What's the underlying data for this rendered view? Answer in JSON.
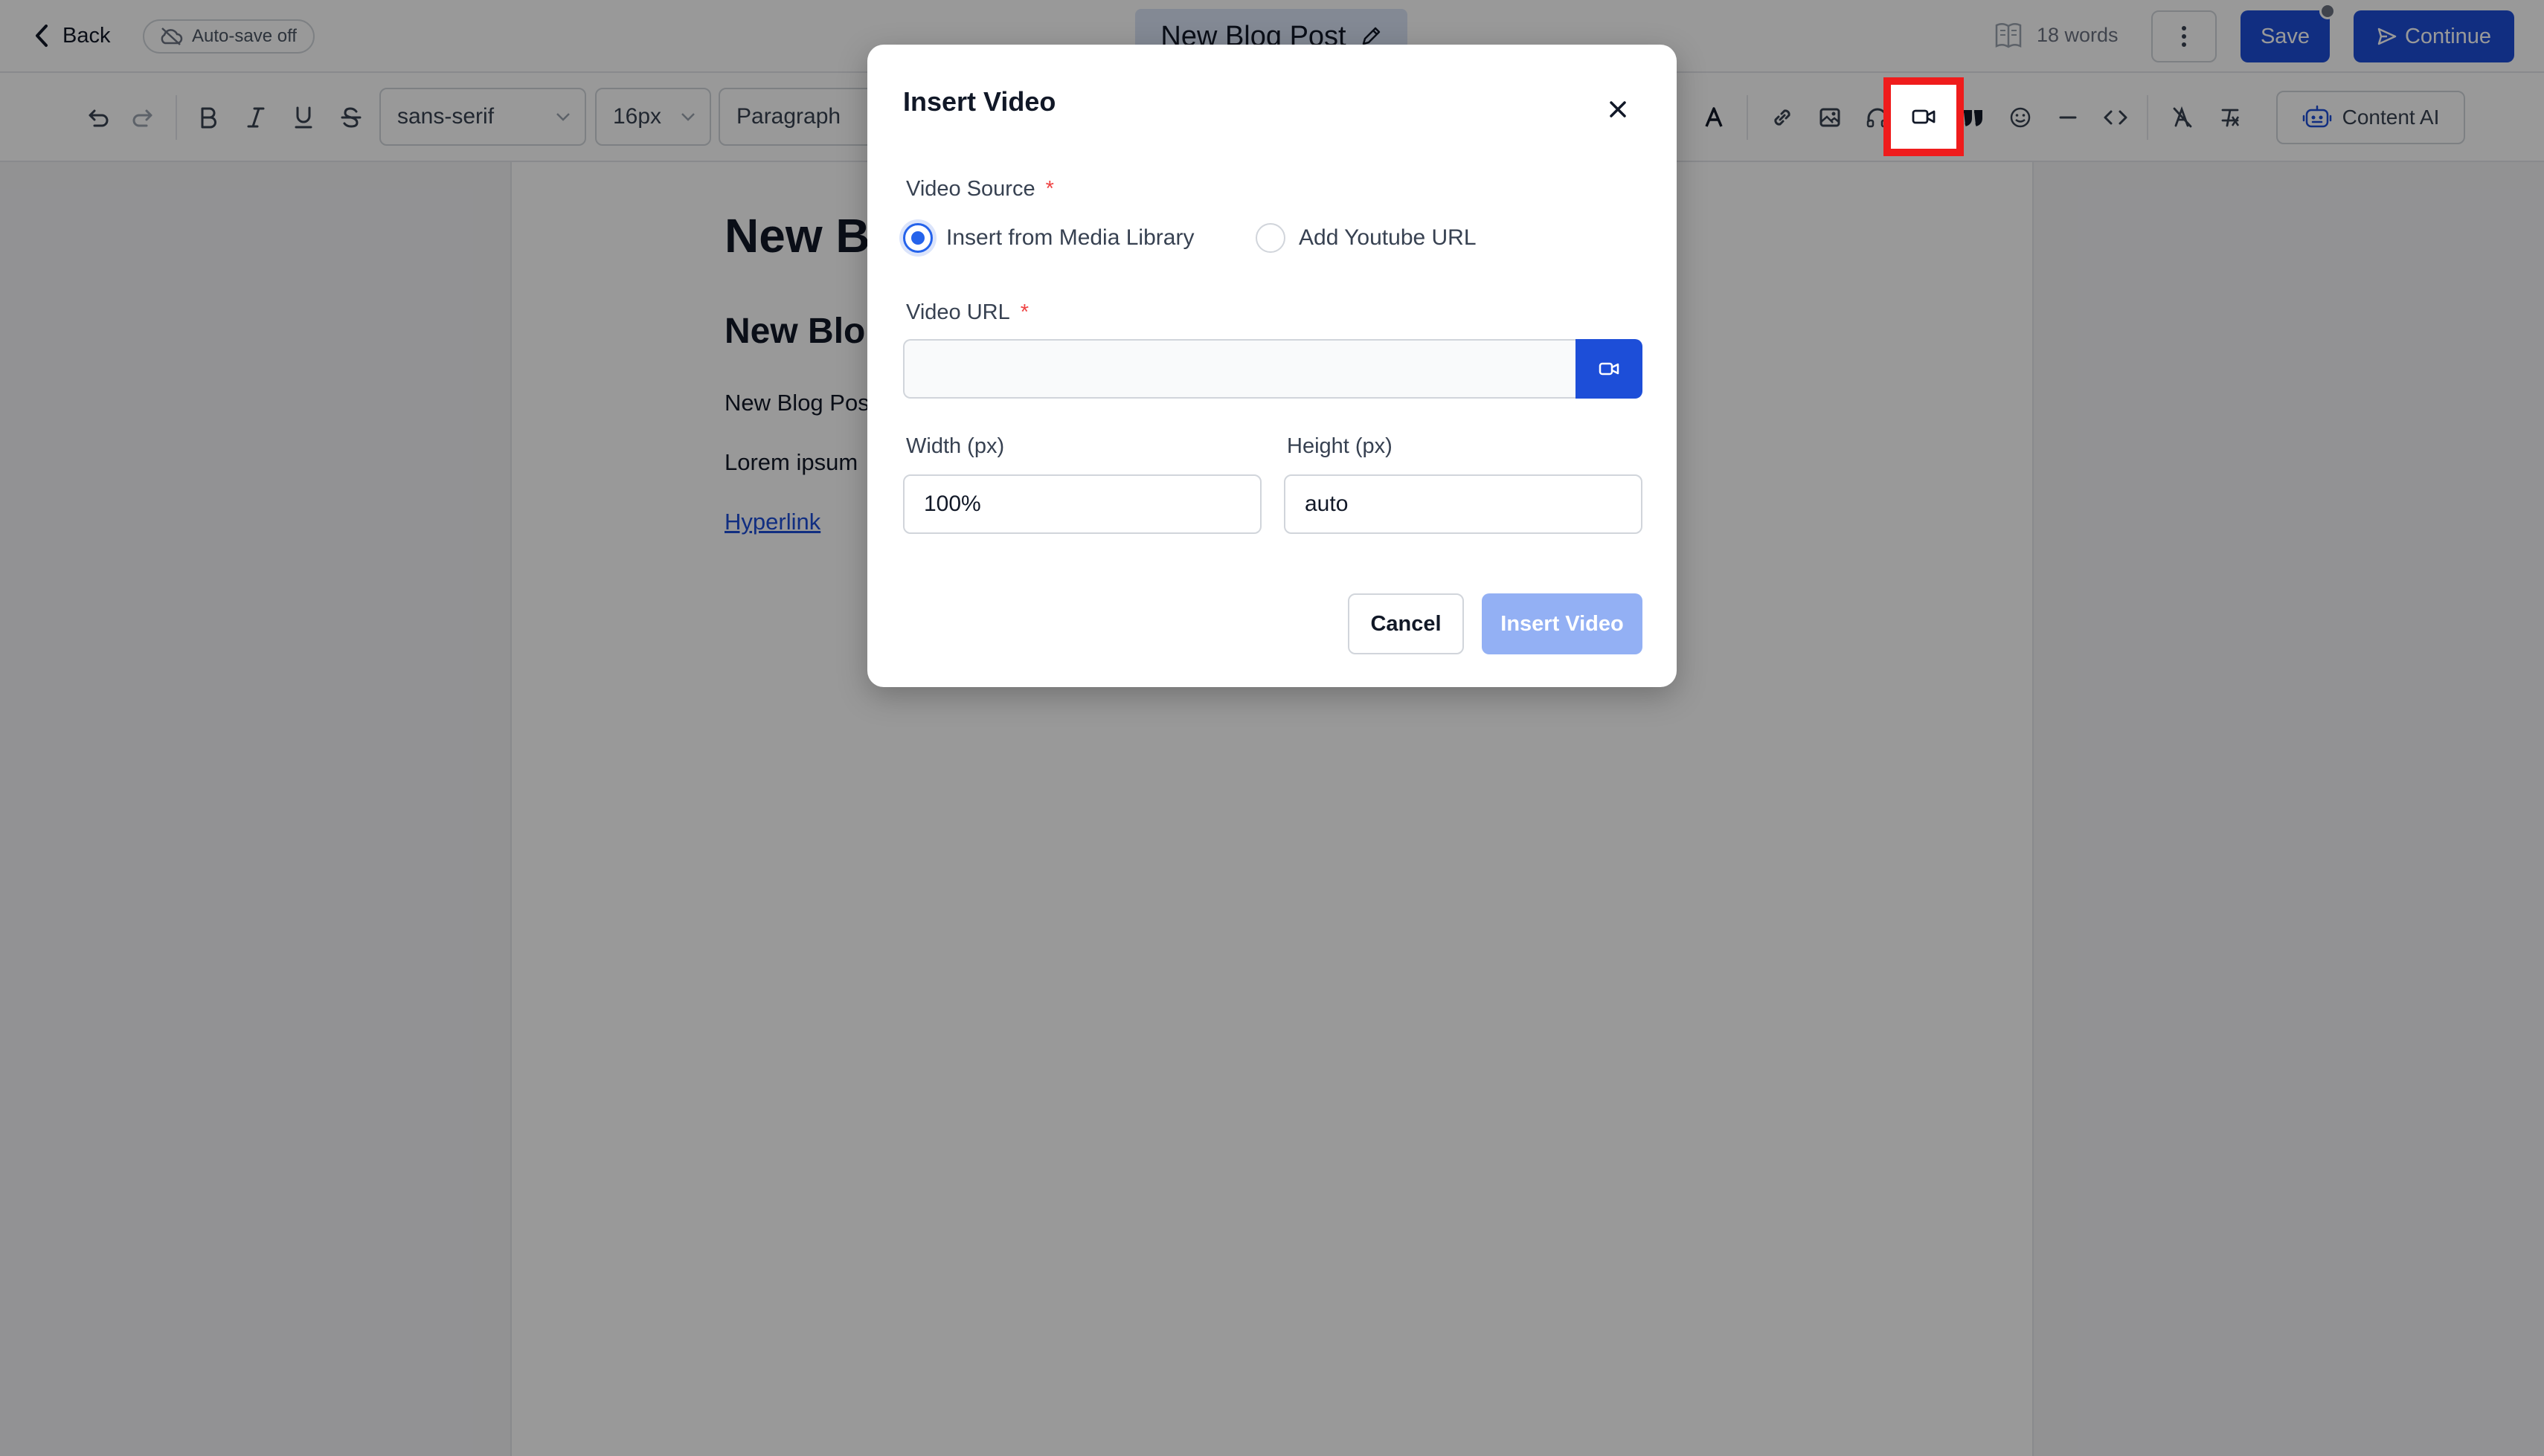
{
  "topbar": {
    "back_label": "Back",
    "autosave_label": "Auto-save off",
    "title": "New Blog Post",
    "word_count": "18 words",
    "save_label": "Save",
    "continue_label": "Continue"
  },
  "toolbar": {
    "font_family": "sans-serif",
    "font_size": "16px",
    "block_type": "Paragraph",
    "content_ai_label": "Content AI",
    "icons": [
      "undo-icon",
      "redo-icon",
      "bold-icon",
      "italic-icon",
      "underline-icon",
      "strikethrough-icon",
      "text-color-icon",
      "link-icon",
      "image-icon",
      "audio-icon",
      "video-icon",
      "quote-icon",
      "emoji-icon",
      "horizontal-rule-icon",
      "code-icon",
      "clear-format-icon",
      "remove-format-icon"
    ]
  },
  "document": {
    "heading1": "New B",
    "heading2": "New Blo",
    "paragraph1": "New Blog Pos",
    "paragraph2": "Lorem ipsum",
    "link": "Hyperlink"
  },
  "modal": {
    "title": "Insert Video",
    "video_source_label": "Video Source",
    "required_mark": "*",
    "source_options": [
      "Insert from Media Library",
      "Add Youtube URL"
    ],
    "selected_source": "Insert from Media Library",
    "video_url_label": "Video URL",
    "video_url_value": "",
    "width_label": "Width (px)",
    "width_value": "100%",
    "height_label": "Height (px)",
    "height_value": "auto",
    "cancel_label": "Cancel",
    "insert_label": "Insert Video"
  },
  "colors": {
    "primary": "#1d4ed8",
    "primary_disabled": "#93b0f4",
    "highlight": "#ef1c1c",
    "required": "#ef4444"
  }
}
